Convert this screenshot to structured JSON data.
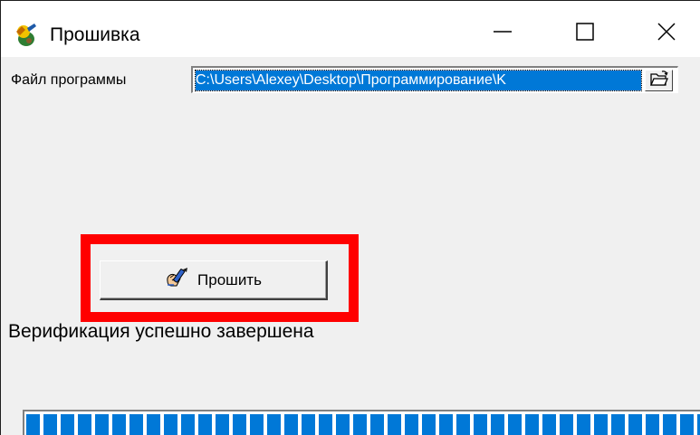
{
  "window": {
    "title": "Прошивка",
    "icon": "flashing-app-icon",
    "controls": {
      "minimize_icon": "minimize-icon",
      "maximize_icon": "maximize-icon",
      "close_icon": "close-icon"
    }
  },
  "file": {
    "label": "Файл программы",
    "value": "C:\\Users\\Alexey\\Desktop\\Программирование\\K",
    "browse_icon": "open-folder-icon"
  },
  "flash_button": {
    "label": "Прошить",
    "icon": "hand-pencil-icon"
  },
  "status": {
    "text": "Верификация успешно завершена"
  },
  "progress": {
    "fraction": 1.0,
    "color": "#0078d7"
  },
  "highlight": {
    "color": "#ff0000"
  },
  "colors": {
    "selection": "#0078d7",
    "window_bg": "#f0f0f0"
  }
}
